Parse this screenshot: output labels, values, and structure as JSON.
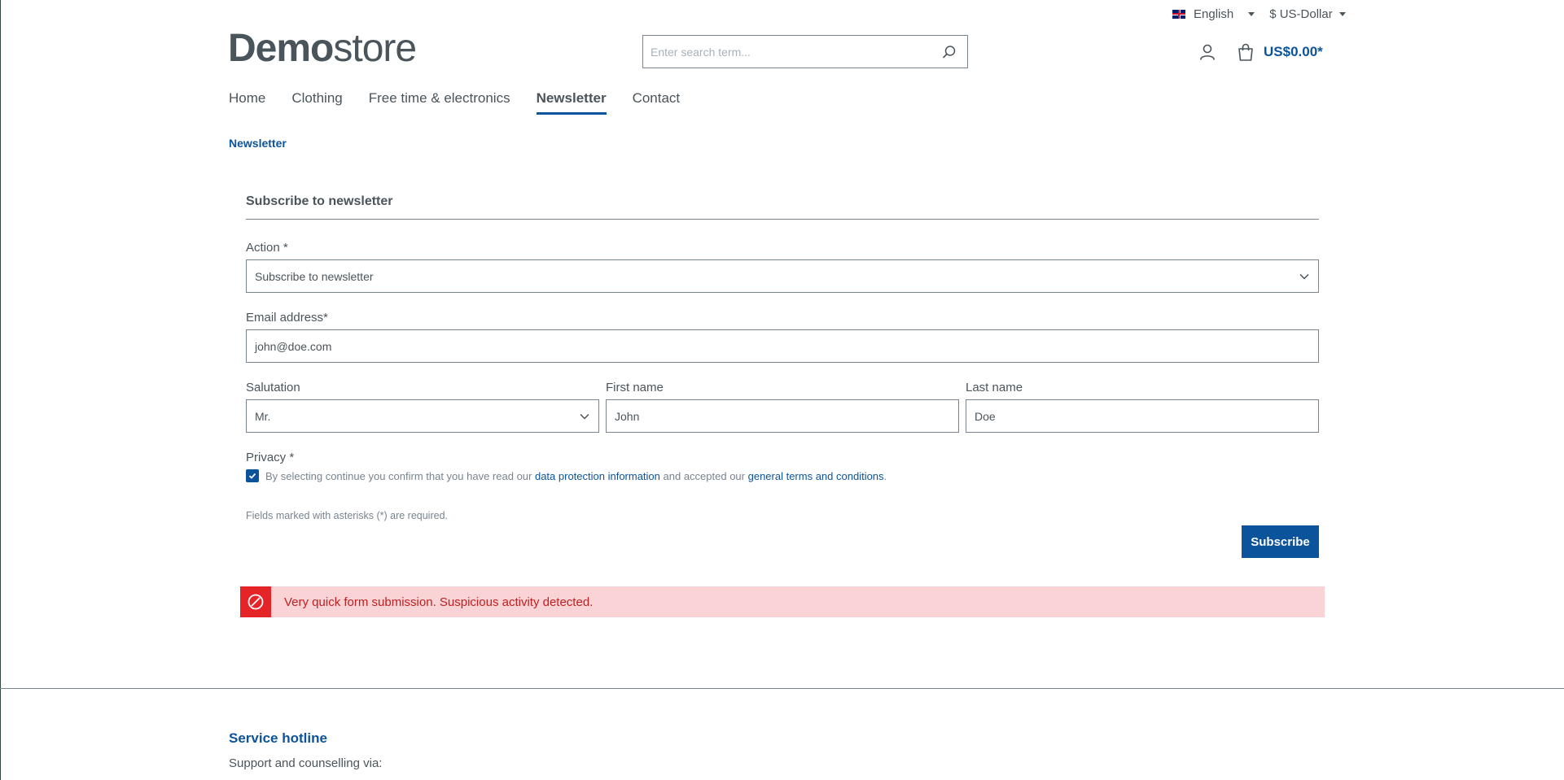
{
  "topbar": {
    "language": "English",
    "currency": "$ US-Dollar"
  },
  "header": {
    "logo_bold": "Demo",
    "logo_light": "store",
    "search_placeholder": "Enter search term...",
    "cart_total": "US$0.00*"
  },
  "nav": {
    "items": [
      {
        "label": "Home"
      },
      {
        "label": "Clothing"
      },
      {
        "label": "Free time & electronics"
      },
      {
        "label": "Newsletter",
        "active": true
      },
      {
        "label": "Contact"
      }
    ]
  },
  "breadcrumb": "Newsletter",
  "form": {
    "title": "Subscribe to newsletter",
    "action_label": "Action *",
    "action_value": "Subscribe to newsletter",
    "email_label": "Email address*",
    "email_value": "john@doe.com",
    "salutation_label": "Salutation",
    "salutation_value": "Mr.",
    "first_name_label": "First name",
    "first_name_value": "John",
    "last_name_label": "Last name",
    "last_name_value": "Doe",
    "privacy_label": "Privacy *",
    "privacy_text_1": "By selecting continue you confirm that you have read our ",
    "privacy_link_1": "data protection information",
    "privacy_text_2": " and accepted our ",
    "privacy_link_2": "general terms and conditions",
    "privacy_text_3": ".",
    "privacy_checked": true,
    "required_note": "Fields marked with asterisks (*) are required.",
    "submit_label": "Subscribe"
  },
  "alert": {
    "message": "Very quick form submission. Suspicious activity detected."
  },
  "footer": {
    "title": "Service hotline",
    "text": "Support and counselling via:"
  },
  "colors": {
    "primary": "#0b539b",
    "danger": "#e52427",
    "danger_bg": "#fad3d6",
    "text": "#4a545b"
  }
}
